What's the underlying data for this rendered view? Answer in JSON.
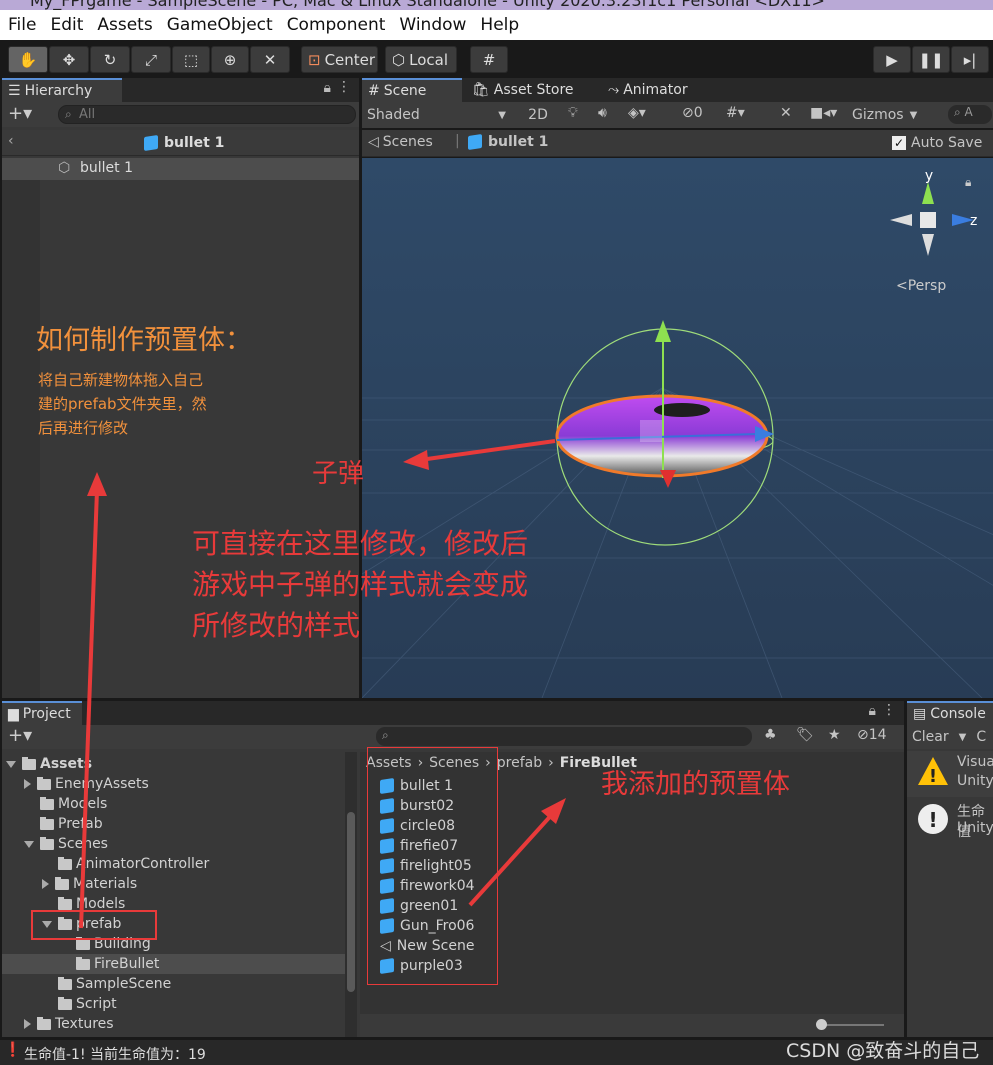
{
  "window_title": "My_FPrgame - SampleScene - PC, Mac & Linux Standalone - Unity 2020.3.23f1c1 Personal <DX11>",
  "menu": [
    "File",
    "Edit",
    "Assets",
    "GameObject",
    "Component",
    "Window",
    "Help"
  ],
  "toolbar": {
    "center_label": "Center",
    "local_label": "Local"
  },
  "hierarchy": {
    "tab_label": "Hierarchy",
    "search_placeholder": "All",
    "prefab_header": "bullet 1",
    "items": [
      "bullet 1"
    ]
  },
  "scene": {
    "tabs": [
      "Scene",
      "Asset Store",
      "Animator"
    ],
    "shading": "Shaded",
    "mode_2d": "2D",
    "hidden_count": "0",
    "gizmos_label": "Gizmos",
    "breadcrumb_root": "Scenes",
    "breadcrumb_current": "bullet 1",
    "auto_save_label": "Auto Save",
    "persp_label": "<Persp",
    "axis_y": "y",
    "axis_z": "z"
  },
  "project": {
    "tab_label": "Project",
    "hidden_count": "14",
    "tree": [
      {
        "label": "Assets",
        "depth": 0,
        "bold": true,
        "arrow": "down"
      },
      {
        "label": "EnemyAssets",
        "depth": 1,
        "arrow": "right"
      },
      {
        "label": "Models",
        "depth": 1,
        "arrow": ""
      },
      {
        "label": "Prefab",
        "depth": 1,
        "arrow": ""
      },
      {
        "label": "Scenes",
        "depth": 1,
        "arrow": "down"
      },
      {
        "label": "AnimatorController",
        "depth": 2,
        "arrow": ""
      },
      {
        "label": "Materials",
        "depth": 2,
        "arrow": "right"
      },
      {
        "label": "Models",
        "depth": 2,
        "arrow": ""
      },
      {
        "label": "prefab",
        "depth": 2,
        "arrow": "down"
      },
      {
        "label": "Building",
        "depth": 3,
        "arrow": ""
      },
      {
        "label": "FireBullet",
        "depth": 3,
        "arrow": "",
        "selected": true
      },
      {
        "label": "SampleScene",
        "depth": 2,
        "arrow": ""
      },
      {
        "label": "Script",
        "depth": 2,
        "arrow": ""
      },
      {
        "label": "Textures",
        "depth": 1,
        "arrow": "right"
      }
    ],
    "path": [
      "Assets",
      "Scenes",
      "prefab",
      "FireBullet"
    ],
    "files": [
      "bullet 1",
      "burst02",
      "circle08",
      "firefie07",
      "firelight05",
      "firework04",
      "green01",
      "Gun_Fro06",
      "New Scene",
      "purple03"
    ]
  },
  "console": {
    "tab_label": "Console",
    "clear_label": "Clear",
    "entries": [
      {
        "line1": "Visua",
        "line2": "Unity"
      },
      {
        "line1": "生命值",
        "line2": "Unity"
      }
    ]
  },
  "status_bar": "生命值-1! 当前生命值为：19",
  "watermark": "CSDN @致奋斗的自己",
  "annotations": {
    "how_title": "如何制作预置体：",
    "how_body": [
      "将自己新建物体拖入自己",
      "建的prefab文件夹里，然",
      "后再进行修改"
    ],
    "bullet_label": "子弹",
    "edit_note": [
      "可直接在这里修改，修改后",
      "游戏中子弹的样式就会变成",
      "所修改的样式"
    ],
    "added_prefabs": "我添加的预置体"
  },
  "colors": {
    "anno_orange": "#f2913c",
    "anno_red": "#e83a3a",
    "scene_bg": "#2c3e56",
    "selection": "#2c5d87",
    "tab_accent": "#5a8fd6"
  }
}
